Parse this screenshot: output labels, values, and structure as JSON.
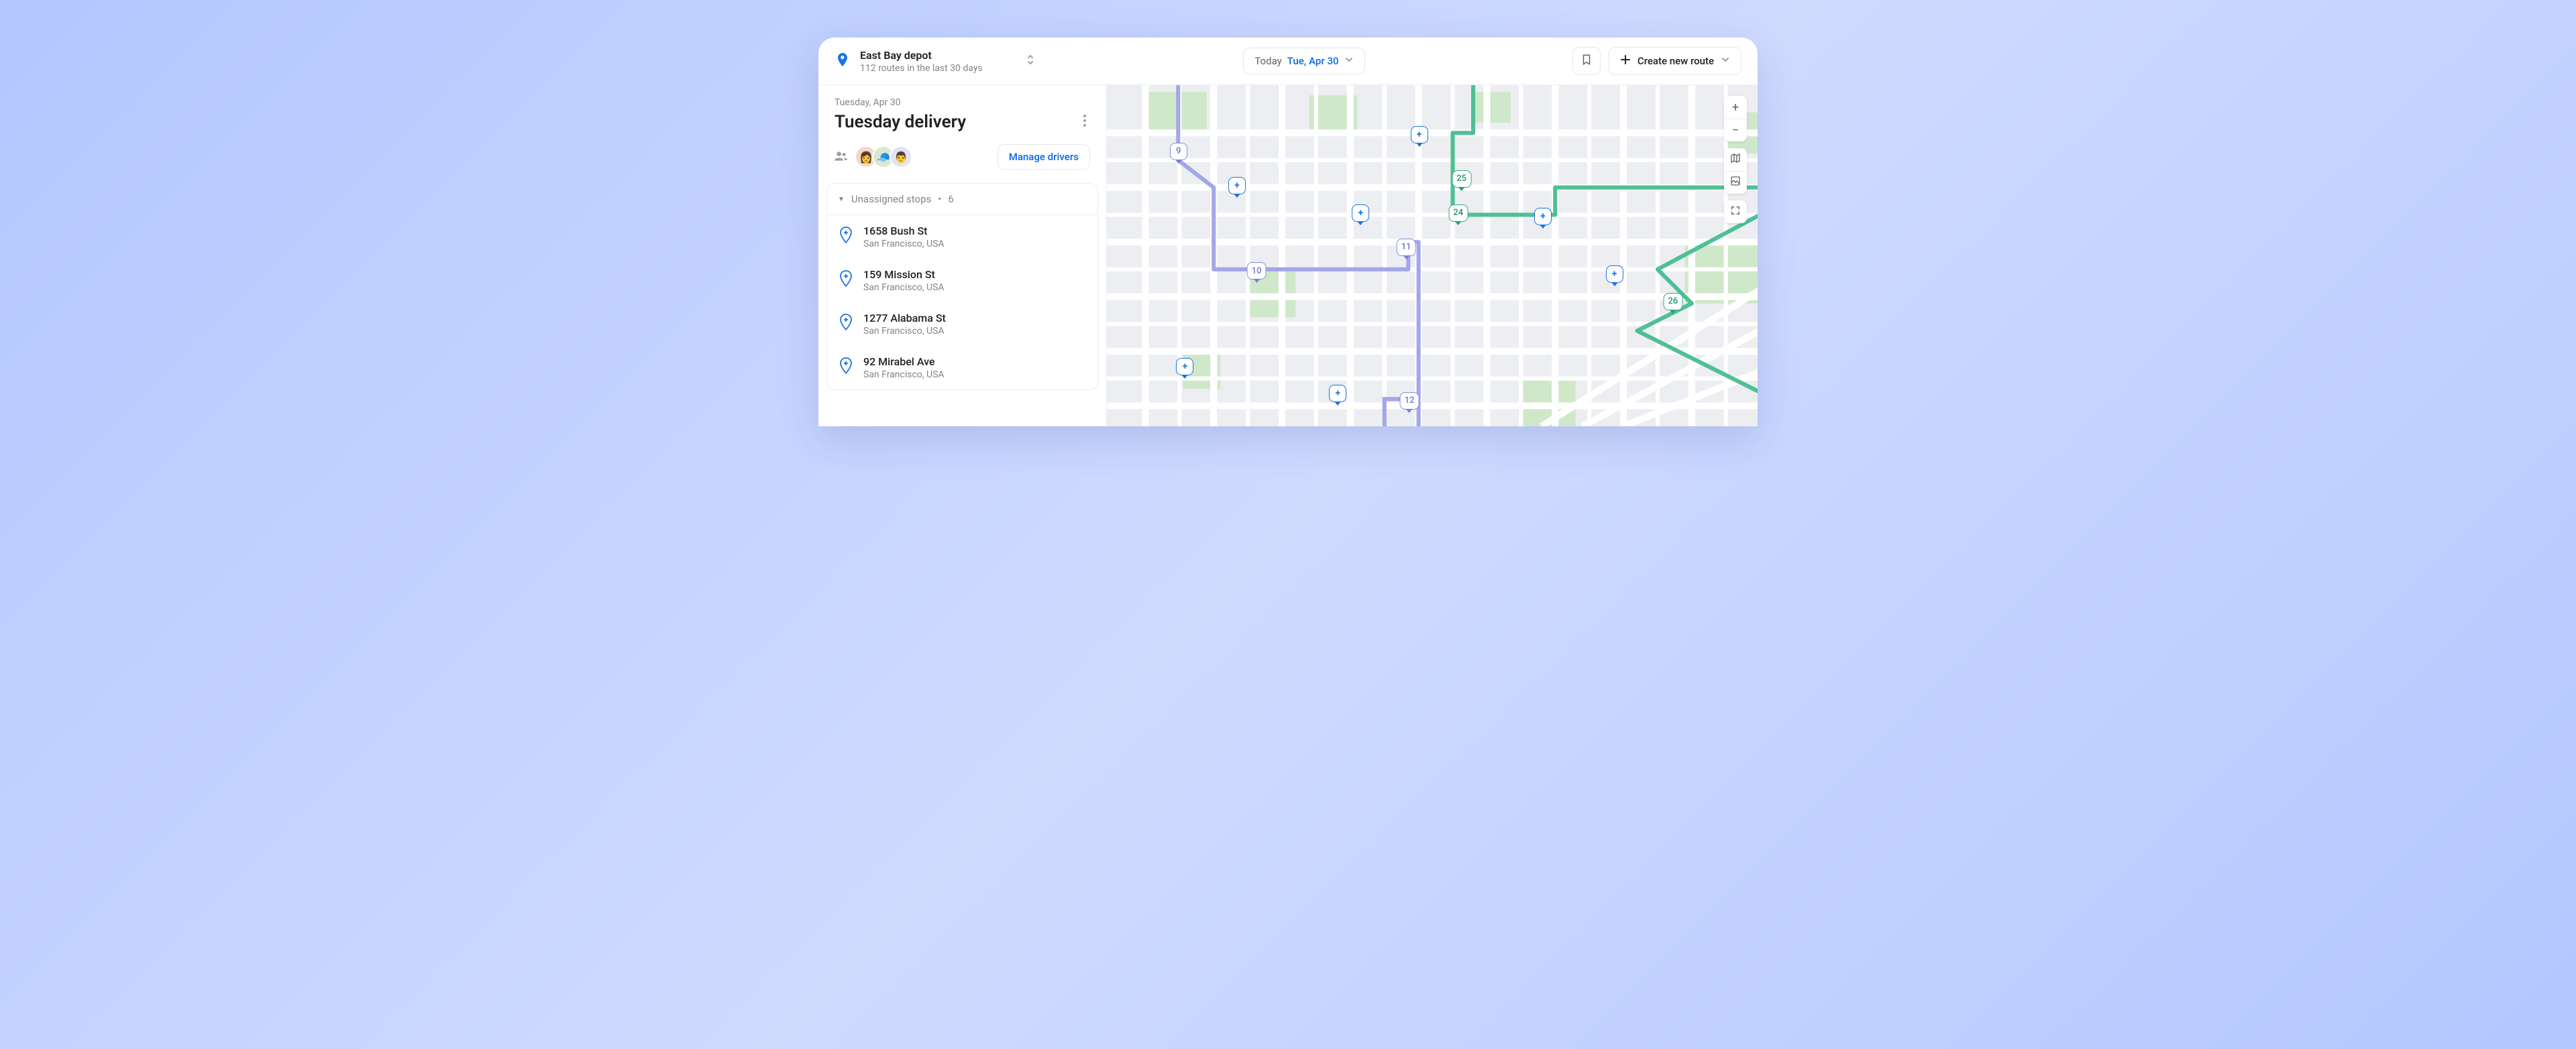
{
  "depot": {
    "name": "East Bay depot",
    "subtitle": "112 routes in the last 30 days"
  },
  "date_picker": {
    "prefix": "Today",
    "date": "Tue, Apr 30"
  },
  "create_button": "Create new route",
  "route": {
    "date_line": "Tuesday, Apr 30",
    "title": "Tuesday delivery",
    "manage_drivers": "Manage drivers",
    "driver_avatars": [
      "👩",
      "🧢",
      "👨"
    ]
  },
  "unassigned": {
    "label": "Unassigned stops",
    "separator": "•",
    "count": "6",
    "items": [
      {
        "address": "1658 Bush St",
        "city": "San Francisco, USA"
      },
      {
        "address": "159 Mission St",
        "city": "San Francisco, USA"
      },
      {
        "address": "1277 Alabama St",
        "city": "San Francisco, USA"
      },
      {
        "address": "92 Mirabel Ave",
        "city": "San Francisco, USA"
      }
    ]
  },
  "map_markers": [
    {
      "label": "9",
      "style": "purple",
      "x": 11,
      "y": 22
    },
    {
      "label": "+",
      "style": "blue",
      "x": 20,
      "y": 32,
      "plus": true
    },
    {
      "label": "10",
      "style": "purple",
      "x": 23,
      "y": 57
    },
    {
      "label": "+",
      "style": "blue",
      "x": 12,
      "y": 85,
      "plus": true
    },
    {
      "label": "+",
      "style": "blue",
      "x": 35.5,
      "y": 93,
      "plus": true
    },
    {
      "label": "11",
      "style": "purple",
      "x": 46,
      "y": 50
    },
    {
      "label": "12",
      "style": "purple",
      "x": 46.5,
      "y": 95
    },
    {
      "label": "+",
      "style": "blue",
      "x": 39,
      "y": 40,
      "plus": true
    },
    {
      "label": "+",
      "style": "blue",
      "x": 48,
      "y": 17,
      "plus": true
    },
    {
      "label": "25",
      "style": "green",
      "x": 54.5,
      "y": 30
    },
    {
      "label": "24",
      "style": "green",
      "x": 54,
      "y": 40
    },
    {
      "label": "+",
      "style": "blue",
      "x": 67,
      "y": 41,
      "plus": true
    },
    {
      "label": "+",
      "style": "blue",
      "x": 78,
      "y": 58,
      "plus": true
    },
    {
      "label": "26",
      "style": "green",
      "x": 87,
      "y": 66
    }
  ]
}
